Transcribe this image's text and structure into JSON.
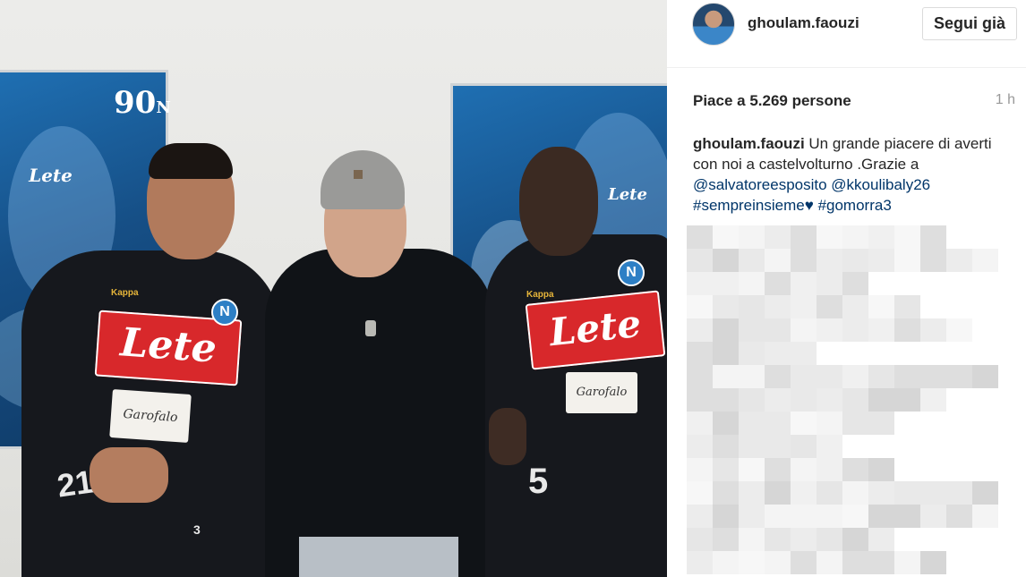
{
  "photo": {
    "poster_logo_text": "90",
    "poster_logo_letter": "N",
    "sponsor_main": "Lete",
    "sponsor_secondary": "Garofalo",
    "brand": "Kappa",
    "left_player_number": "21",
    "left_player_small_number": "3",
    "right_player_number": "5"
  },
  "post": {
    "username": "ghoulam.faouzi",
    "follow_label": "Segui già",
    "likes_text": "Piace a 5.269 persone",
    "time_ago": "1 h",
    "caption": {
      "author": "ghoulam.faouzi",
      "text_part1": "Un grande piacere di averti con noi a castelvolturno .Grazie a",
      "mention1": "@salvatoreesposito",
      "mention2": "@kkoulibaly26",
      "hashtag1": "#sempreinsieme",
      "heart": "♥",
      "hashtag2": "#gomorra3"
    }
  },
  "colors": {
    "link": "#003569",
    "napoli_blue": "#1f6fb2",
    "lete_red": "#d8282b"
  }
}
